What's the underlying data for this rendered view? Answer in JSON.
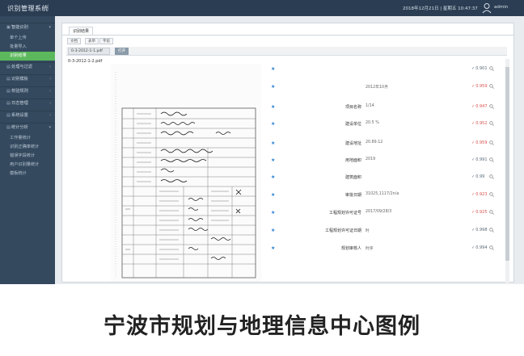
{
  "header": {
    "app_title": "识别管理系统",
    "separator": "|",
    "datetime": "2018年12月21日 | 星期五 10:47:37",
    "user": "admin"
  },
  "sidebar": {
    "items": [
      {
        "label": "智能识别",
        "kind": "group",
        "glyph": "▣",
        "caret": "▾"
      },
      {
        "label": "单个上传",
        "kind": "sub"
      },
      {
        "label": "批量导入",
        "kind": "sub"
      },
      {
        "label": "识别结果",
        "kind": "sub",
        "active": true
      },
      {
        "label": "处理与过滤",
        "kind": "group",
        "glyph": "▤",
        "caret": "‹"
      },
      {
        "label": "识别模板",
        "kind": "group",
        "glyph": "▤",
        "caret": "‹"
      },
      {
        "label": "校验规则",
        "kind": "group",
        "glyph": "▤",
        "caret": "‹"
      },
      {
        "label": "日志管理",
        "kind": "group",
        "glyph": "▤",
        "caret": "‹"
      },
      {
        "label": "系统设置",
        "kind": "group",
        "glyph": "▤",
        "caret": "‹"
      },
      {
        "label": "统计分析",
        "kind": "group",
        "glyph": "▤",
        "caret": "▾"
      },
      {
        "label": "工作量统计",
        "kind": "sub"
      },
      {
        "label": "识别正确率统计",
        "kind": "sub"
      },
      {
        "label": "错误字段统计",
        "kind": "sub"
      },
      {
        "label": "用户识别量统计",
        "kind": "sub"
      },
      {
        "label": "模板统计",
        "kind": "sub"
      }
    ]
  },
  "main": {
    "tab_label": "识别结果",
    "subtabs": [
      "文档",
      "表单",
      "字段"
    ],
    "file_select_value": "0-3-2012-1-1.pdf",
    "open_button": "打开",
    "filename": "0-3-2012-1-2.pdf"
  },
  "fields": [
    {
      "label": "",
      "value": "",
      "conf": "0.901",
      "level": "ok"
    },
    {
      "label": "",
      "value": "2012年10月",
      "conf": "0.959",
      "level": "low"
    },
    {
      "label": "项目名称",
      "value": "1/14",
      "conf": "0.947",
      "level": "low"
    },
    {
      "label": "建设单位",
      "value": "20.5 %",
      "conf": "0.952",
      "level": "low"
    },
    {
      "label": "建设地址",
      "value": "20.89.12",
      "conf": "0.959",
      "level": "low"
    },
    {
      "label": "用地面积",
      "value": "2019",
      "conf": "0.991",
      "level": "ok"
    },
    {
      "label": "建筑面积",
      "value": "",
      "conf": "0.99",
      "level": "ok"
    },
    {
      "label": "审批日期",
      "value": "31025,1117/2n/a",
      "conf": "0.923",
      "level": "low"
    },
    {
      "label": "工程规划许可证号",
      "value": "2017/09/28/3",
      "conf": "0.925",
      "level": "low"
    },
    {
      "label": "工程规划许可证日期",
      "value": "时",
      "conf": "0.998",
      "level": "ok"
    },
    {
      "label": "规划审核人",
      "value": "时序",
      "conf": "0.994",
      "level": "ok"
    }
  ],
  "caption": "宁波市规划与地理信息中心图例"
}
